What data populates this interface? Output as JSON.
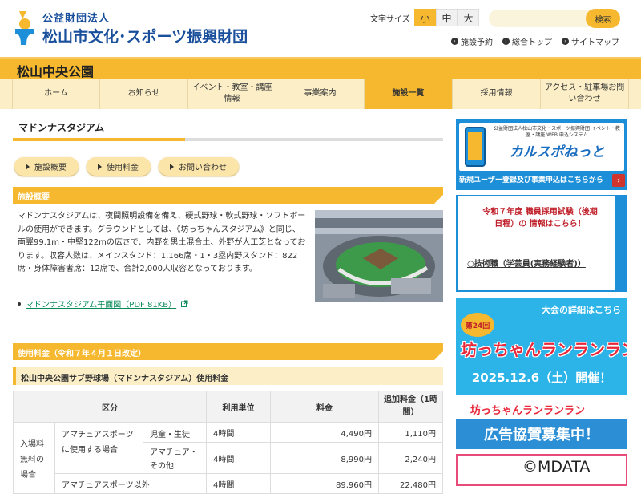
{
  "header": {
    "org_small": "公益財団法人",
    "org_name": "松山市文化･スポーツ振興財団",
    "fontsize_label": "文字サイズ",
    "fontsizes": [
      "小",
      "中",
      "大"
    ],
    "search_placeholder": "",
    "search_button": "検索",
    "links": [
      "施設予約",
      "総合トップ",
      "サイトマップ"
    ]
  },
  "park_title": "松山中央公園",
  "nav": [
    "ホーム",
    "お知らせ",
    "イベント・教室・講座情報",
    "事業案内",
    "施設一覧",
    "採用情報",
    "アクセス・駐車場お問い合わせ"
  ],
  "page_title": "マドンナスタジアム",
  "pills": [
    "施設概要",
    "使用料金",
    "お問い合わせ"
  ],
  "overview": {
    "heading": "施設概要",
    "description": "マドンナスタジアムは、夜間照明設備を備え、硬式野球・軟式野球・ソフトボールの使用ができます。グラウンドとしては、《坊っちゃんスタジアム》と同じ、両翼99.1m・中堅122mの広さで、内野を黒土混合土、外野が人工芝となっております。収容人数は、メインスタンド：1,166席・1・3塁内野スタンド：822席・身体障害者席：12席で、合計2,000人収容となっております。",
    "pdf_link": "マドンナスタジアム平面図（PDF 81KB）"
  },
  "fees": {
    "heading": "使用料金（令和７年４月１日改定）",
    "subheading": "松山中央公園サブ野球場（マドンナスタジアム）使用料金",
    "headers": [
      "区分",
      "利用単位",
      "料金",
      "追加料金（1時間）"
    ],
    "group_label": "入場料無料の場合",
    "rows": [
      {
        "category": "アマチュアスポーツに使用する場合",
        "sub": "児童・生徒",
        "unit": "4時間",
        "fee": "4,490円",
        "extra": "1,110円"
      },
      {
        "category": "",
        "sub": "アマチュア・その他",
        "unit": "4時間",
        "fee": "8,990円",
        "extra": "2,240円"
      },
      {
        "category": "アマチュアスポーツ以外",
        "sub": "",
        "unit": "4時間",
        "fee": "89,960円",
        "extra": "22,480円"
      }
    ]
  },
  "banners": {
    "b1_title": "カルスポねっと",
    "b1_top": "公益財団法人松山市文化・スポーツ振興財団 イベント・教室・講座 WEB 申込システム",
    "b1_sub": "新規ユーザー登録及び事業申込はこちらから",
    "b2_text": "令和７年度 職員採用試験（後期日程）の 情報はこちら！",
    "b2_link": "○技術職（学芸員(実務経験者)）",
    "b3_top": "大会の詳細はこちら",
    "b3_badge": "第24回",
    "b3_title": "坊っちゃんランランラン",
    "b3_date": "2025.12.6（土）開催！",
    "b4_title": "坊っちゃんランランラン",
    "b4_text": "広告協賛募集中！"
  },
  "watermark": "©MDATA",
  "colors": {
    "accent": "#f5b82e",
    "nav_bg": "#fcefc8",
    "brand_blue": "#1a4f9c"
  }
}
